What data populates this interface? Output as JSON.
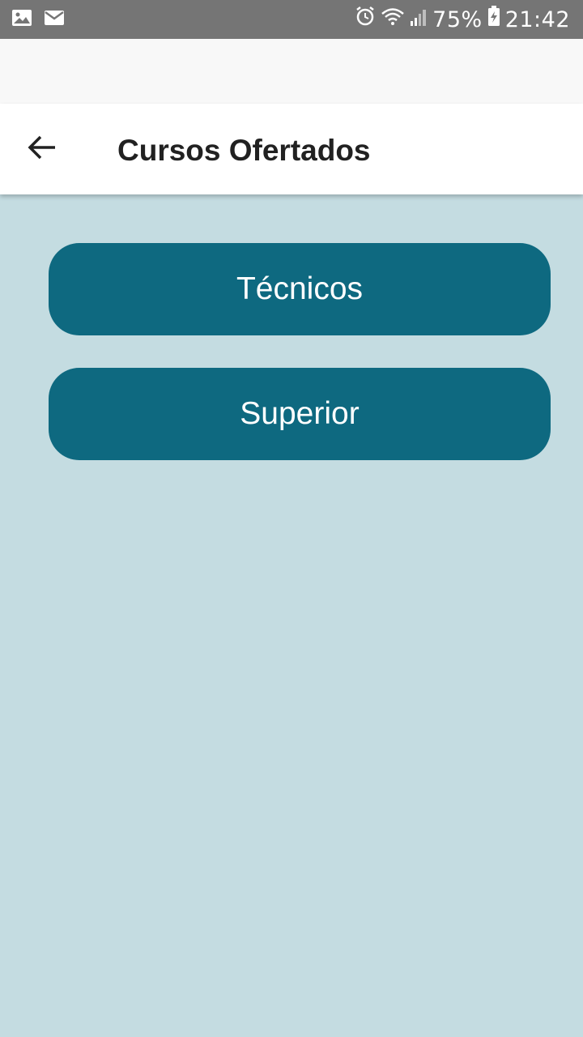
{
  "status_bar": {
    "battery": "75%",
    "time": "21:42",
    "icons": [
      "image-icon",
      "mail-icon",
      "alarm-icon",
      "wifi-icon",
      "signal-icon",
      "battery-charging-icon"
    ]
  },
  "app_bar": {
    "title": "Cursos Ofertados",
    "back_icon": "arrow-back-icon"
  },
  "main": {
    "buttons": [
      {
        "label": "Técnicos"
      },
      {
        "label": "Superior"
      }
    ]
  },
  "colors": {
    "status_bar": "#757575",
    "background": "#c4dce1",
    "button": "#0e6980",
    "button_text": "#ffffff",
    "title_text": "#212121"
  }
}
